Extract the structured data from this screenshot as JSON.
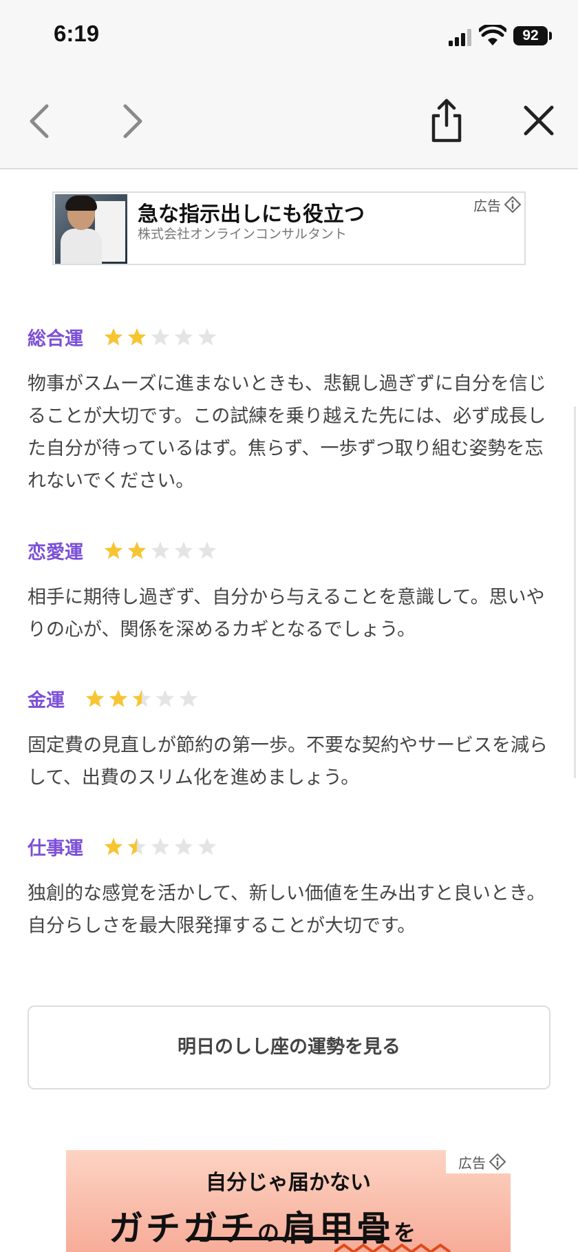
{
  "status_bar": {
    "time": "6:19",
    "battery": "92"
  },
  "top_ad": {
    "title": "急な指示出しにも役立つ",
    "company": "株式会社オンラインコンサルタント",
    "label": "広告"
  },
  "fortunes": [
    {
      "title": "総合運",
      "rating": 2,
      "text": "物事がスムーズに進まないときも、悲観し過ぎずに自分を信じることが大切です。この試練を乗り越えた先には、必ず成長した自分が待っているはず。焦らず、一歩ずつ取り組む姿勢を忘れないでください。"
    },
    {
      "title": "恋愛運",
      "rating": 2,
      "text": "相手に期待し過ぎず、自分から与えることを意識して。思いやりの心が、関係を深めるカギとなるでしょう。"
    },
    {
      "title": "金運",
      "rating": 2.5,
      "text": "固定費の見直しが節約の第一歩。不要な契約やサービスを減らして、出費のスリム化を進めましょう。"
    },
    {
      "title": "仕事運",
      "rating": 1.5,
      "text": "独創的な感覚を活かして、新しい価値を生み出すと良いとき。自分らしさを最大限発揮することが大切です。"
    }
  ],
  "tomorrow_button": "明日のしし座の運勢を見る",
  "bottom_ad": {
    "label": "広告",
    "subtitle": "自分じゃ届かない",
    "headline_a": "ガチガチ",
    "headline_b": "の",
    "headline_c": "肩甲骨",
    "headline_d": "を"
  },
  "colors": {
    "accent": "#7b4fd6",
    "star_on": "#f7c531",
    "star_off": "#e4e4e4"
  }
}
